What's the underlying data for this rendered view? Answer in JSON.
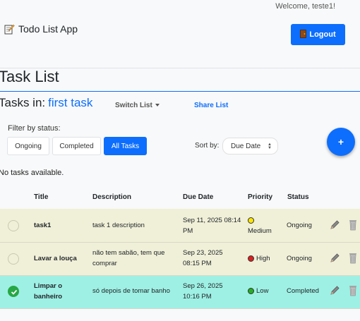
{
  "header": {
    "welcome": "Welcome, teste1!",
    "brand": "Todo List App",
    "logout_label": "Logout"
  },
  "page_title": "Task List",
  "tasks_in": {
    "prefix": "Tasks in:",
    "list_name": "first task"
  },
  "switch_list_label": "Switch List",
  "share_list_label": "Share List",
  "filter": {
    "label": "Filter by status:",
    "options": [
      "Ongoing",
      "Completed",
      "All Tasks"
    ],
    "active": "All Tasks"
  },
  "sort": {
    "label": "Sort by:",
    "selected": "Due Date"
  },
  "add_button_label": "+",
  "empty_message": "No tasks available.",
  "columns": [
    "Title",
    "Description",
    "Due Date",
    "Priority",
    "Status"
  ],
  "tasks": [
    {
      "title": "task1",
      "description": "task 1 description",
      "due": "Sep 11, 2025 08:14 PM",
      "priority": "Medium",
      "priority_color": "#ffe600",
      "status": "Ongoing",
      "completed": false
    },
    {
      "title": "Lavar a louça",
      "description": "não tem sabão, tem que comprar",
      "due": "Sep 23, 2025 08:15 PM",
      "priority": "High",
      "priority_color": "#dc1e1e",
      "status": "Ongoing",
      "completed": false
    },
    {
      "title": "Limpar o banheiro",
      "description": "só depois de tomar banho",
      "due": "Sep 26, 2025 10:16 PM",
      "priority": "Low",
      "priority_color": "#22b022",
      "status": "Completed",
      "completed": true
    }
  ],
  "colors": {
    "primary": "#0d6efd",
    "row_ongoing": "#f0f0d8",
    "row_completed": "#9ef0e4",
    "check_done": "#28a745"
  },
  "icons": {
    "brand": "memo-icon",
    "logout": "door-icon",
    "edit": "pencil-icon",
    "delete": "trash-icon"
  }
}
